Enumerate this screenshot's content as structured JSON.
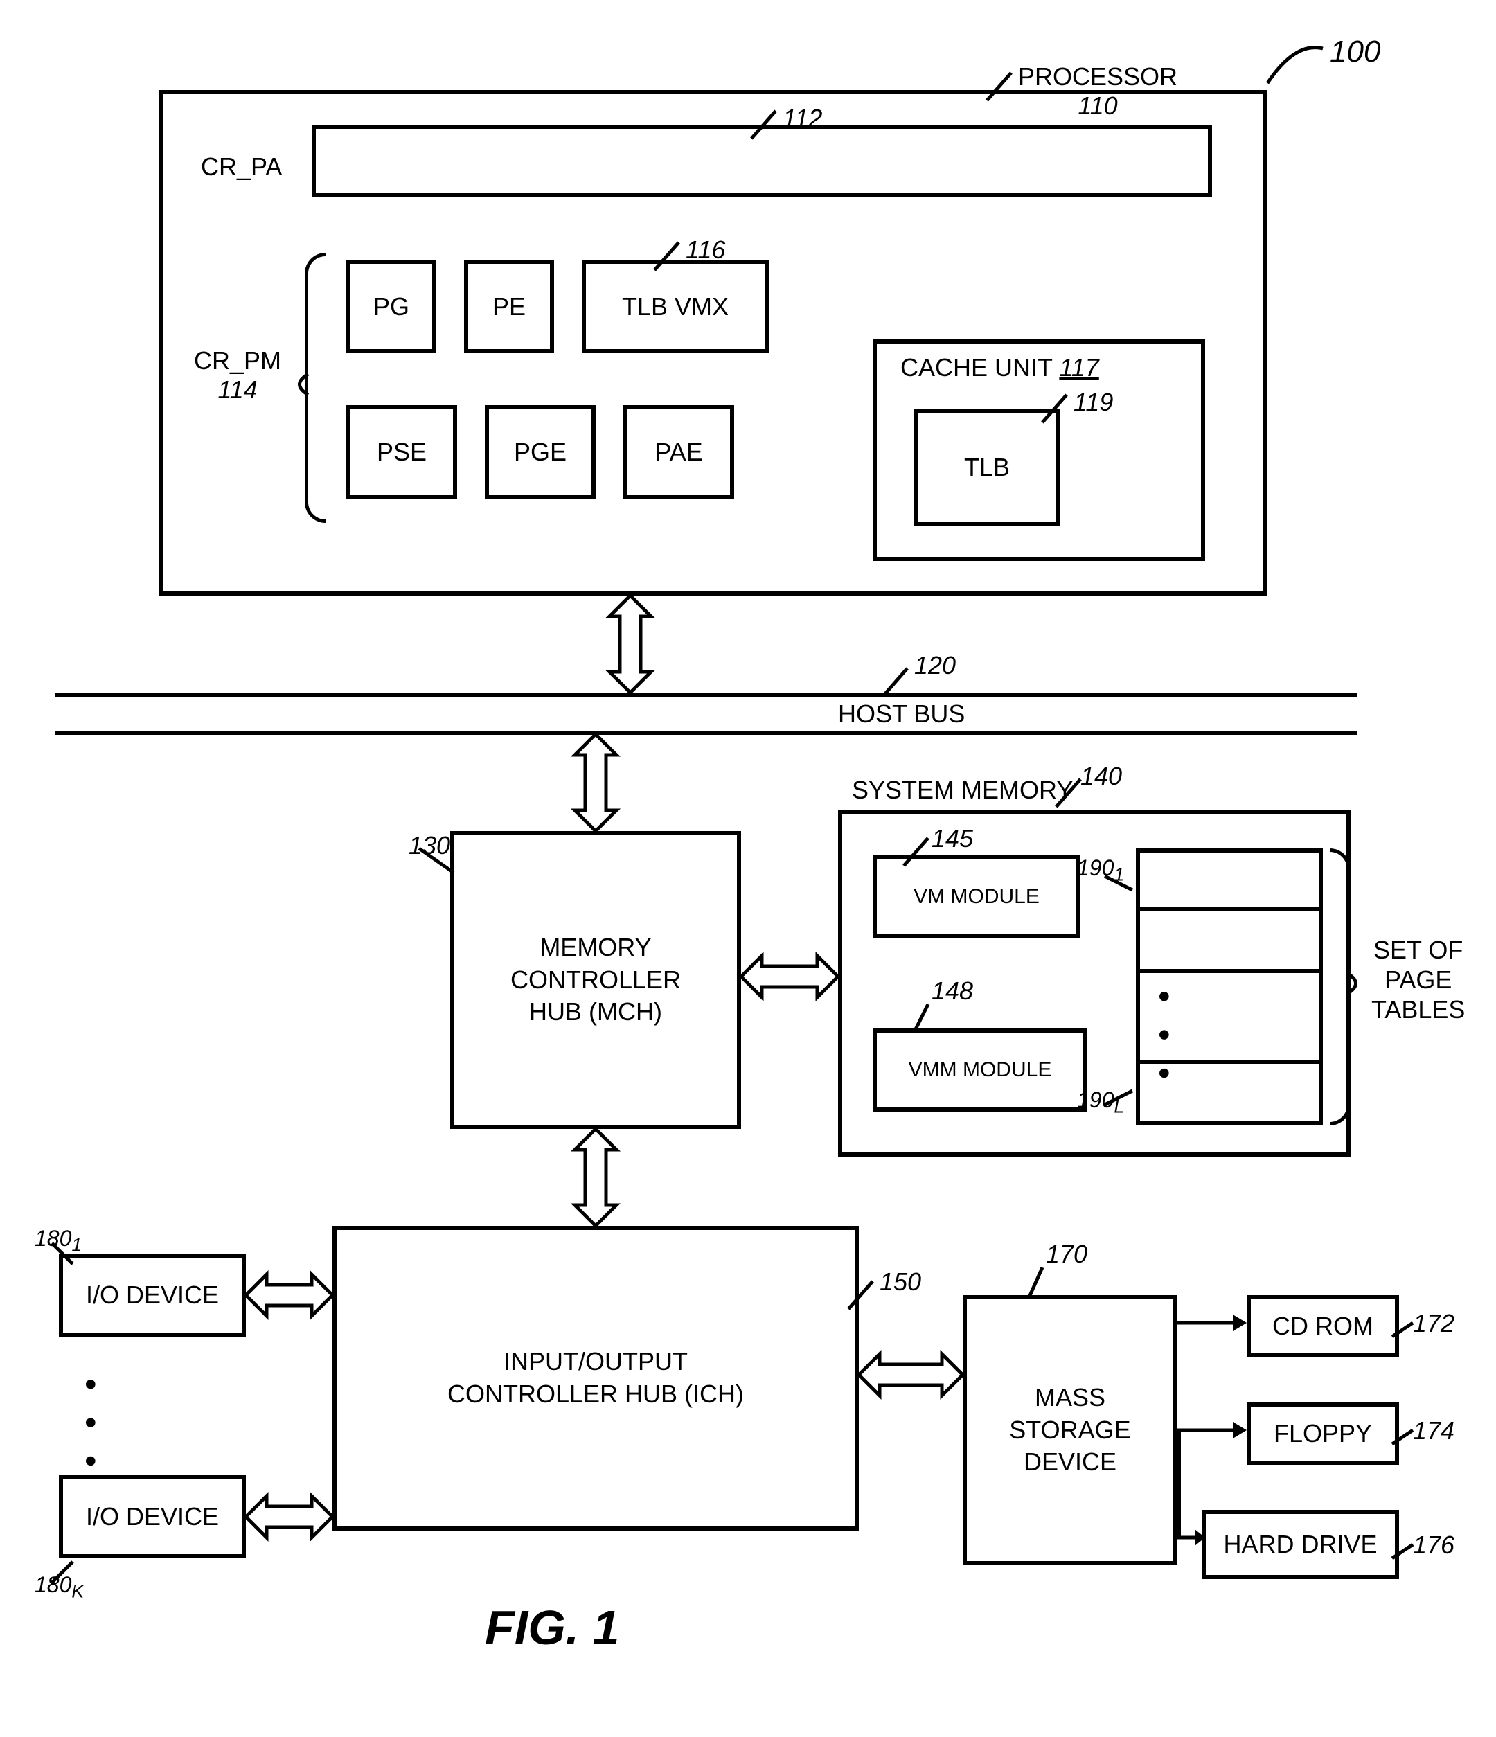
{
  "fig_title": "FIG. 1",
  "system_ref": "100",
  "processor": {
    "label": "PROCESSOR",
    "ref": "110",
    "cr_pa": {
      "label": "CR_PA",
      "ref": "112"
    },
    "cr_pm": {
      "label": "CR_PM",
      "ref": "114"
    },
    "bits": {
      "pg": "PG",
      "pe": "PE",
      "pse": "PSE",
      "pge": "PGE",
      "pae": "PAE"
    },
    "tlb_vmx": {
      "label": "TLB VMX",
      "ref": "116"
    },
    "cache_unit": {
      "label": "CACHE UNIT",
      "ref": "117"
    },
    "tlb": {
      "label": "TLB",
      "ref": "119"
    }
  },
  "host_bus": {
    "label": "HOST BUS",
    "ref": "120"
  },
  "mch": {
    "line1": "MEMORY",
    "line2": "CONTROLLER",
    "line3": "HUB (MCH)",
    "ref": "130"
  },
  "system_memory": {
    "label": "SYSTEM MEMORY",
    "ref": "140"
  },
  "vm_module": {
    "label": "VM MODULE",
    "ref": "145"
  },
  "vmm_module": {
    "label": "VMM MODULE",
    "ref": "148"
  },
  "page_tables": {
    "line1": "SET OF",
    "line2": "PAGE",
    "line3": "TABLES",
    "ref1": "190",
    "sub1": "1",
    "refL": "190",
    "subL": "L"
  },
  "ich": {
    "line1": "INPUT/OUTPUT",
    "line2": "CONTROLLER HUB (ICH)",
    "ref": "150"
  },
  "mass_storage": {
    "line1": "MASS",
    "line2": "STORAGE",
    "line3": "DEVICE",
    "ref": "170"
  },
  "cd_rom": {
    "label": "CD ROM",
    "ref": "172"
  },
  "floppy": {
    "label": "FLOPPY",
    "ref": "174"
  },
  "hard_drive": {
    "label": "HARD DRIVE",
    "ref": "176"
  },
  "io_device1": {
    "label": "I/O DEVICE",
    "ref": "180",
    "sub": "1"
  },
  "io_deviceK": {
    "label": "I/O DEVICE",
    "ref": "180",
    "sub": "K"
  },
  "dots": "• • •"
}
